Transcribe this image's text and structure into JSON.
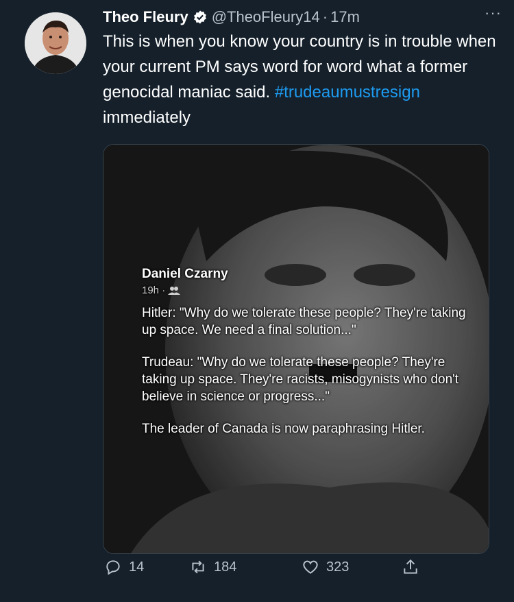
{
  "tweet": {
    "author_name": "Theo Fleury",
    "handle": "@TheoFleury14",
    "separator": "·",
    "time": "17m",
    "more_label": "···",
    "text": "This is when you know your country is in trouble when your current PM says word for word what a former genocidal maniac said.",
    "hashtag": "#trudeaumustresign",
    "text_after_hashtag": " immediately"
  },
  "embedded_post": {
    "author": "Daniel Czarny",
    "meta_time": "19h ·",
    "paragraph_1": "Hitler: \"Why do we tolerate these people? They're taking up space. We need a final solution...\"",
    "paragraph_2": "Trudeau: \"Why do we tolerate these people? They're taking up space. They're racists, misogynists who don't believe in science or progress...\"",
    "paragraph_3": "The leader of Canada is now paraphrasing Hitler."
  },
  "actions": {
    "reply_count": "14",
    "retweet_count": "184",
    "like_count": "323"
  },
  "colors": {
    "background": "#15202b",
    "accent": "#1d9bf0",
    "muted": "#b9c3cc"
  }
}
